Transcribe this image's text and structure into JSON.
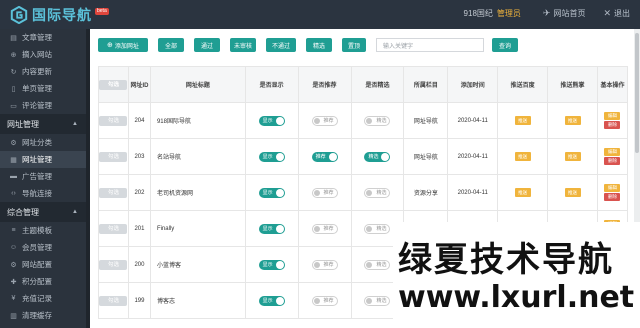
{
  "header": {
    "logo_text": "国际导航",
    "badge": "beta",
    "site_name": "918国纪",
    "role": "管理员",
    "home_link": "网站首页",
    "logout": "退出"
  },
  "sidebar": [
    {
      "type": "item",
      "label": "文章管理",
      "icon": "file-icon"
    },
    {
      "type": "item",
      "label": "摘入网站",
      "icon": "plus-circle-icon"
    },
    {
      "type": "item",
      "label": "内容更新",
      "icon": "refresh-icon"
    },
    {
      "type": "item",
      "label": "单页管理",
      "icon": "page-icon"
    },
    {
      "type": "item",
      "label": "评论管理",
      "icon": "comment-icon"
    },
    {
      "type": "group",
      "label": "网址管理"
    },
    {
      "type": "item",
      "label": "网址分类",
      "icon": "cog-icon"
    },
    {
      "type": "item",
      "label": "网址管理",
      "icon": "grid-icon",
      "active": true
    },
    {
      "type": "item",
      "label": "广告管理",
      "icon": "ad-icon"
    },
    {
      "type": "item",
      "label": "导航连接",
      "icon": "code-icon"
    },
    {
      "type": "group",
      "label": "综合管理"
    },
    {
      "type": "item",
      "label": "主题模板",
      "icon": "theme-icon"
    },
    {
      "type": "item",
      "label": "会员管理",
      "icon": "user-icon"
    },
    {
      "type": "item",
      "label": "网站配置",
      "icon": "config-icon"
    },
    {
      "type": "item",
      "label": "积分配置",
      "icon": "points-icon"
    },
    {
      "type": "item",
      "label": "充值记录",
      "icon": "money-icon"
    },
    {
      "type": "item",
      "label": "清理缓存",
      "icon": "trash-icon"
    }
  ],
  "toolbar": {
    "add": "添加网址",
    "filters": [
      "全部",
      "通过",
      "未审核",
      "不通过",
      "精选",
      "置顶"
    ],
    "search_placeholder": "输入关键字",
    "search_btn": "查询"
  },
  "table": {
    "headers": [
      "",
      "网址ID",
      "网址标题",
      "是否显示",
      "是否推荐",
      "是否精选",
      "所属栏目",
      "添加时间",
      "推送百度",
      "推送熊掌",
      "基本操作"
    ],
    "select_label": "勾选",
    "on_label": "显示",
    "rec_on": "推荐",
    "rec_off": "推荐",
    "feat_on": "精选",
    "feat_off": "精选",
    "push_label": "推送",
    "edit_label": "编辑",
    "del_label": "删除",
    "rows": [
      {
        "id": "204",
        "title": "918国际导航",
        "show": true,
        "rec": false,
        "feat": false,
        "cat": "网址导航",
        "date": "2020-04-11",
        "baidu": true,
        "xz": true
      },
      {
        "id": "203",
        "title": "名站导航",
        "show": true,
        "rec": true,
        "feat": true,
        "cat": "网址导航",
        "date": "2020-04-11",
        "baidu": true,
        "xz": true
      },
      {
        "id": "202",
        "title": "老司机资源网",
        "show": true,
        "rec": false,
        "feat": false,
        "cat": "资源分享",
        "date": "2020-04-11",
        "baidu": true,
        "xz": true
      },
      {
        "id": "201",
        "title": "Finally",
        "show": true,
        "rec": false,
        "feat": false,
        "cat": "",
        "date": "",
        "baidu": false,
        "xz": false
      },
      {
        "id": "200",
        "title": "小蓝博客",
        "show": true,
        "rec": false,
        "feat": false,
        "cat": "",
        "date": "",
        "baidu": false,
        "xz": false
      },
      {
        "id": "199",
        "title": "博客志",
        "show": true,
        "rec": false,
        "feat": false,
        "cat": "",
        "date": "",
        "baidu": false,
        "xz": false
      }
    ]
  },
  "watermark": {
    "cn": "绿夏技术导航",
    "url": "www.lxurl.net"
  },
  "colors": {
    "accent": "#1f9e93",
    "push": "#f0b43c",
    "delete": "#d9534f",
    "sidebar_bg": "#2b333d"
  }
}
